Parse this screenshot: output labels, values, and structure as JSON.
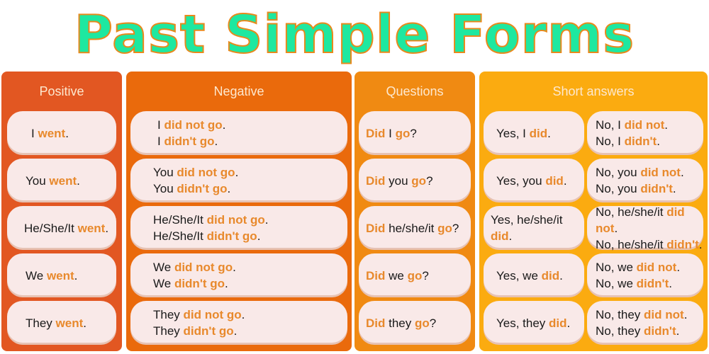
{
  "title": "Past Simple Forms",
  "colors": {
    "title_fill": "#1ee8a0",
    "title_stroke": "#e8891c",
    "highlight": "#e8892c",
    "positive": "#e25722",
    "negative": "#ea6a0c",
    "questions": "#f08a12",
    "short_answers": "#fbab10",
    "pill": "#f9e9e8"
  },
  "columns": {
    "positive": {
      "header": "Positive",
      "rows": [
        {
          "subj": "I",
          "verb": "went",
          "end": "."
        },
        {
          "subj": "You",
          "verb": "went",
          "end": "."
        },
        {
          "subj": "He/She/It",
          "verb": "went",
          "end": "."
        },
        {
          "subj": "We",
          "verb": "went",
          "end": "."
        },
        {
          "subj": "They",
          "verb": "went",
          "end": "."
        }
      ]
    },
    "negative": {
      "header": "Negative",
      "rows": [
        {
          "subj": "I",
          "full": "did not go",
          "short": "didn't go",
          "end": "."
        },
        {
          "subj": "You",
          "full": "did not go",
          "short": "didn't go",
          "end": "."
        },
        {
          "subj": "He/She/It",
          "full": "did not go",
          "short": "didn't go",
          "end": "."
        },
        {
          "subj": "We",
          "full": "did not go",
          "short": "didn't go",
          "end": "."
        },
        {
          "subj": "They",
          "full": "did not go",
          "short": "didn't go",
          "end": "."
        }
      ]
    },
    "questions": {
      "header": "Questions",
      "rows": [
        {
          "aux": "Did",
          "subj": "I",
          "verb": "go",
          "end": "?"
        },
        {
          "aux": "Did",
          "subj": "you",
          "verb": "go",
          "end": "?"
        },
        {
          "aux": "Did",
          "subj": "he/she/it",
          "verb": "go",
          "end": "?"
        },
        {
          "aux": "Did",
          "subj": "we",
          "verb": "go",
          "end": "?"
        },
        {
          "aux": "Did",
          "subj": "they",
          "verb": "go",
          "end": "?"
        }
      ]
    },
    "short_answers": {
      "header": "Short answers",
      "rows": [
        {
          "yes_pre": "Yes, I",
          "yes_verb": "did",
          "no_pre": "No, I",
          "no_full": "did not",
          "no_short": "didn't",
          "end": "."
        },
        {
          "yes_pre": "Yes, you",
          "yes_verb": "did",
          "no_pre": "No, you",
          "no_full": "did not",
          "no_short": "didn't",
          "end": "."
        },
        {
          "yes_pre": "Yes, he/she/it",
          "yes_verb": "did",
          "no_pre": "No, he/she/it",
          "no_full": "did not",
          "no_short": "didn't",
          "end": "."
        },
        {
          "yes_pre": "Yes, we",
          "yes_verb": "did",
          "no_pre": "No, we",
          "no_full": "did not",
          "no_short": "didn't",
          "end": "."
        },
        {
          "yes_pre": "Yes, they",
          "yes_verb": "did",
          "no_pre": "No, they",
          "no_full": "did not",
          "no_short": "didn't",
          "end": "."
        }
      ]
    }
  }
}
